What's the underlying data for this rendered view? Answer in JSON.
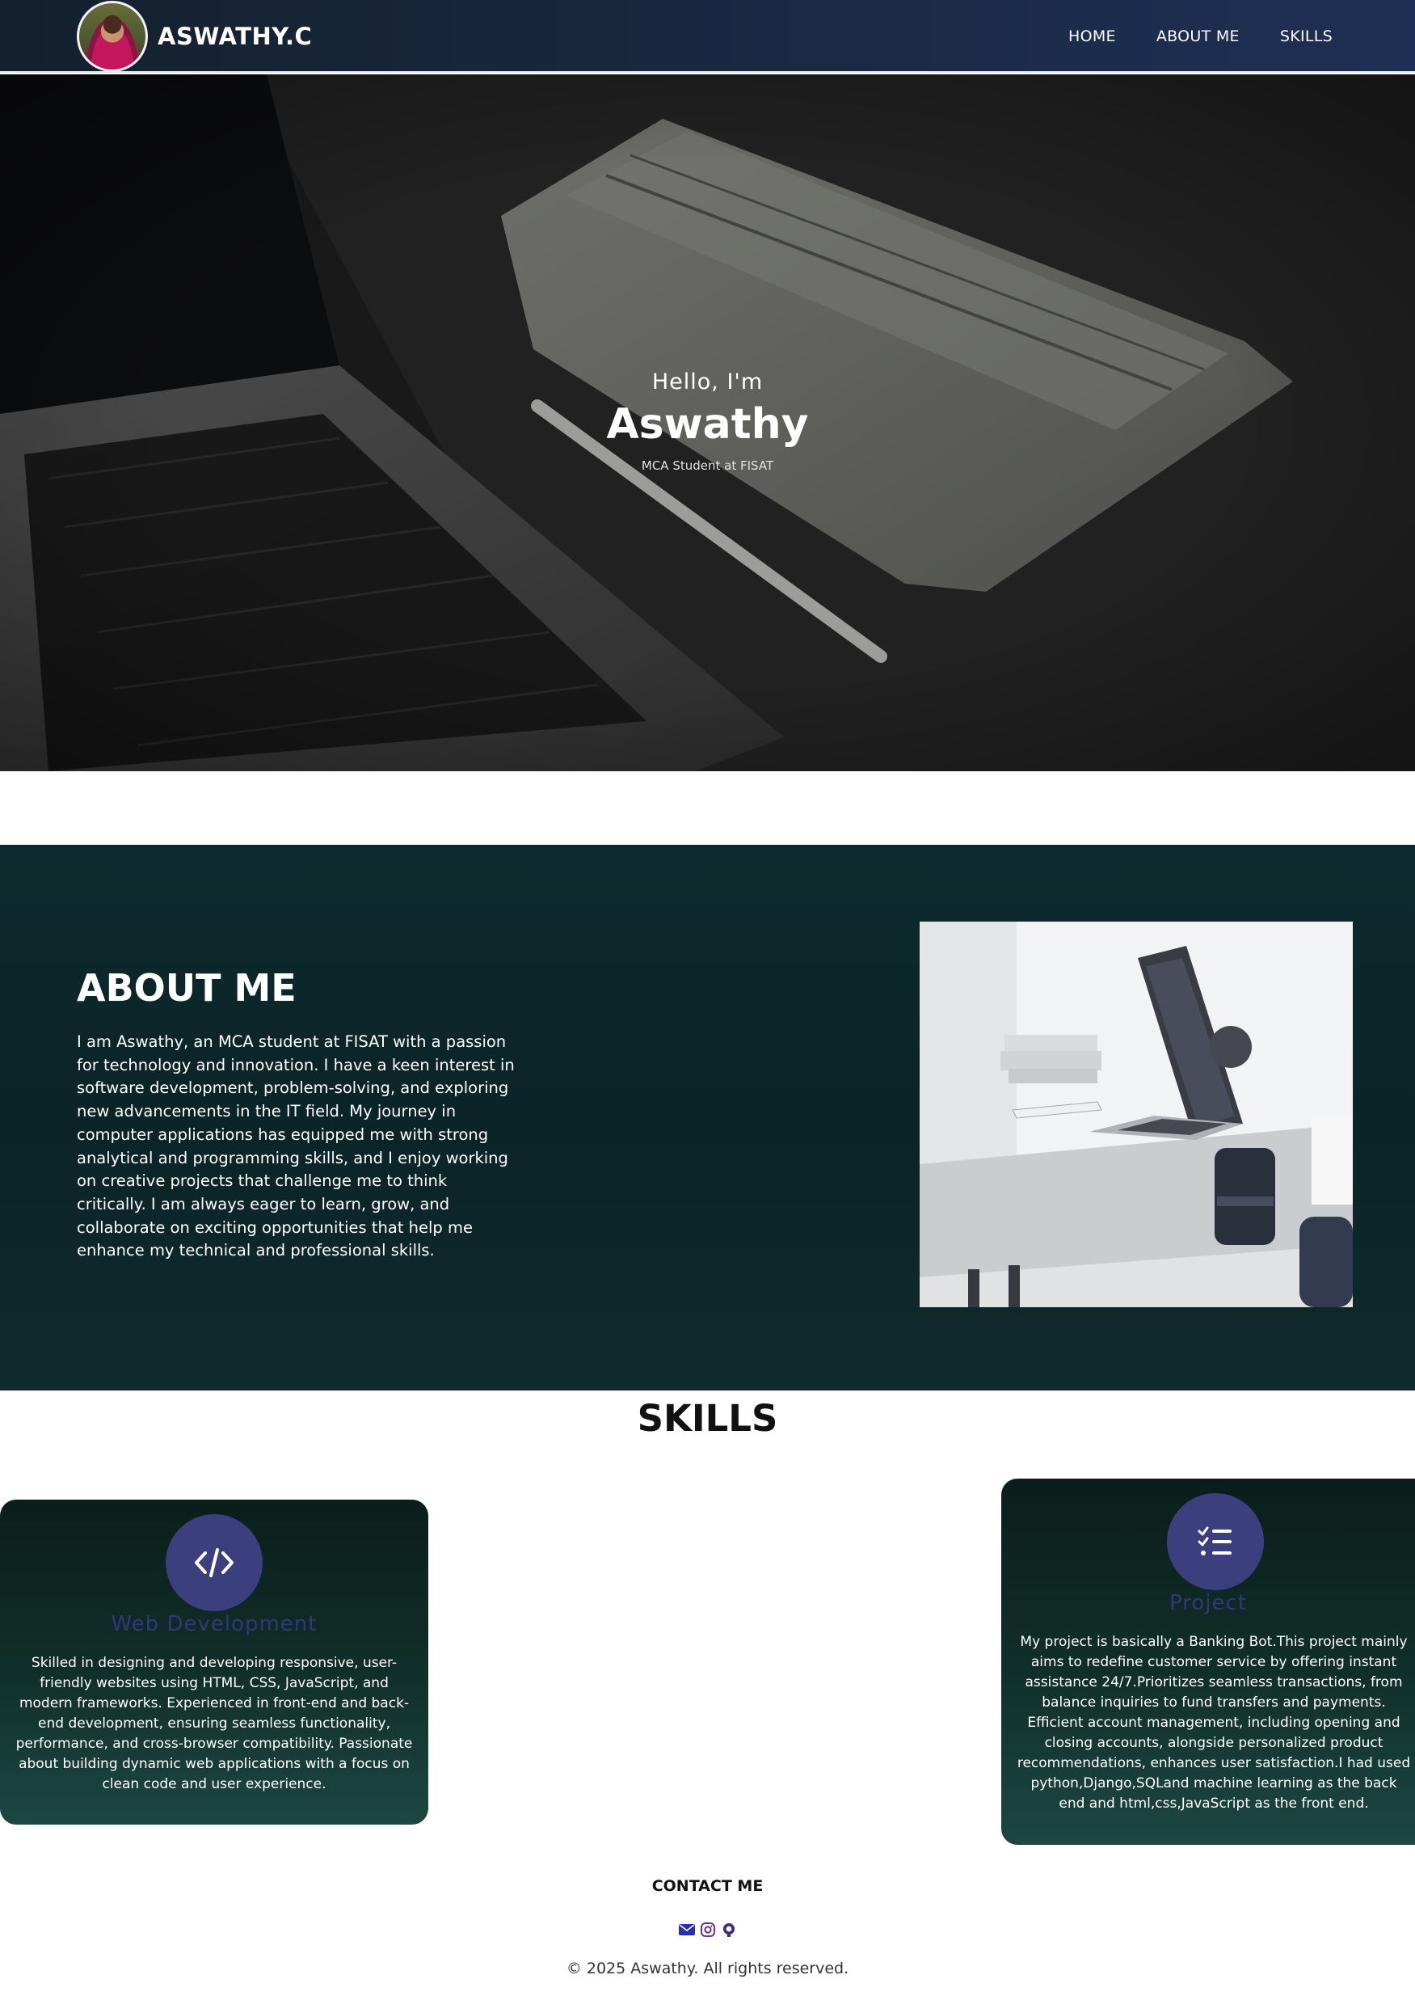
{
  "nav": {
    "brand": "ASWATHY.C",
    "links": [
      "HOME",
      "ABOUT ME",
      "SKILLS"
    ]
  },
  "hero": {
    "greeting": "Hello, I'm",
    "name": "Aswathy",
    "subtitle": "MCA Student at FISAT"
  },
  "about": {
    "title": "ABOUT ME",
    "text": "I am Aswathy, an MCA student at FISAT with a passion for technology and innovation. I have a keen interest in software development, problem-solving, and exploring new advancements in the IT field. My journey in computer applications has equipped me with strong analytical and programming skills, and I enjoy working on creative projects that challenge me to think critically. I am always eager to learn, grow, and collaborate on exciting opportunities that help me enhance my technical and professional skills."
  },
  "skills": {
    "title": "SKILLS",
    "cards": [
      {
        "icon": "code-icon",
        "title": "Web Development",
        "text": "Skilled in designing and developing responsive, user-friendly websites using HTML, CSS, JavaScript, and modern frameworks. Experienced in front-end and back-end development, ensuring seamless functionality, performance, and cross-browser compatibility. Passionate about building dynamic web applications with a focus on clean code and user experience."
      },
      {
        "icon": "list-check-icon",
        "title": "Project",
        "text": "My project is basically a Banking Bot.This project mainly aims to redefine customer service by offering instant assistance 24/7.Prioritizes seamless transactions, from balance inquiries to fund transfers and payments. Efficient account management, including opening and closing accounts, alongside personalized product recommendations, enhances user satisfaction.I had used python,Django,SQLand machine learning as the back end and html,css,JavaScript as the front end."
      }
    ]
  },
  "footer": {
    "contact_title": "CONTACT ME",
    "social_icons": [
      "envelope-icon",
      "instagram-icon",
      "github-icon"
    ],
    "copyright": "© 2025 Aswathy. All rights reserved."
  },
  "colors": {
    "nav_bg": "#1a2a45",
    "about_bg": "#0b2427",
    "icon_circle": "#3b3f7e",
    "card_title": "#2e3a78"
  }
}
